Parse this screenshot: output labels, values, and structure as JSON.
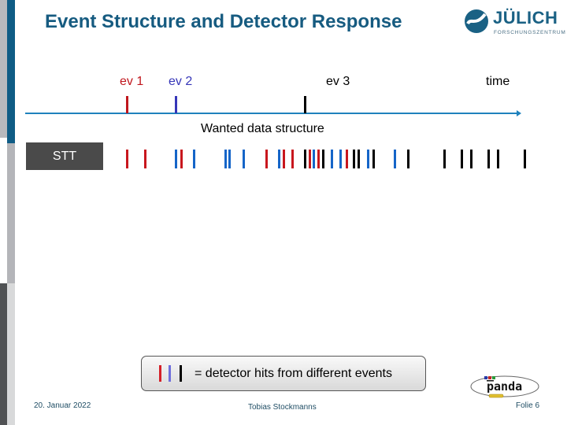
{
  "slide": {
    "title": "Event Structure and Detector Response",
    "logo": {
      "name": "JÜLICH",
      "subtitle": "FORSCHUNGSZENTRUM"
    },
    "colors": {
      "title": "#165b80",
      "event1": "#c0171d",
      "event2": "#3636b8",
      "event3": "#000000",
      "hit_red": "#c8171e",
      "hit_blue": "#1565c8",
      "hit_black": "#000000",
      "timeline": "#1f82bd"
    },
    "timeline": {
      "axis_label": "time",
      "events": [
        {
          "label": "ev 1",
          "color_key": "event1"
        },
        {
          "label": "ev 2",
          "color_key": "event2"
        },
        {
          "label": "ev 3",
          "color_key": "event3"
        }
      ]
    },
    "wanted_label": "Wanted data structure",
    "detector": {
      "name": "STT",
      "hits_event_sequence": [
        "R",
        "R",
        "B",
        "R",
        "B",
        "B",
        "B",
        "B",
        "R",
        "B",
        "R",
        "R",
        "K",
        "R",
        "B",
        "R",
        "K",
        "B",
        "B",
        "R",
        "K",
        "K",
        "B",
        "K",
        "B",
        "K",
        "K",
        "K",
        "K",
        "K",
        "K",
        "K"
      ]
    },
    "legend": {
      "text": "= detector hits from different events",
      "swatches": [
        "red",
        "blue",
        "black"
      ]
    },
    "footer": {
      "date": "20. Januar 2022",
      "author": "Tobias Stockmanns",
      "page": "Folie 6"
    },
    "experiment_logo": "panda"
  }
}
